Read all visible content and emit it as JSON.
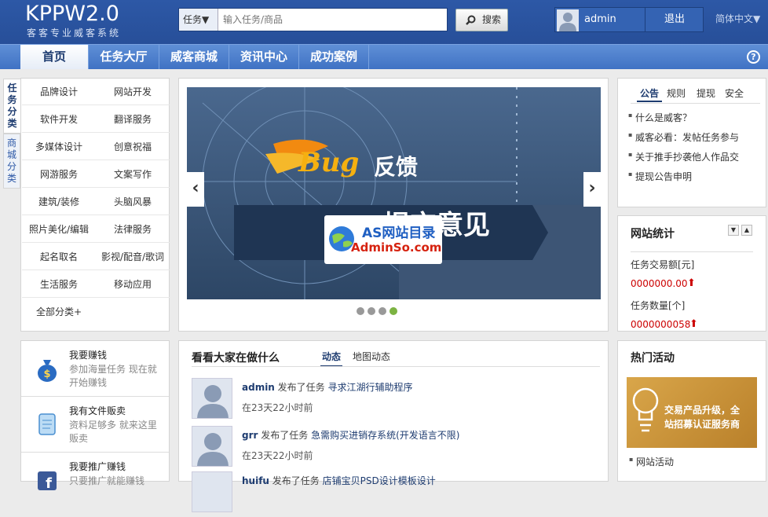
{
  "header": {
    "logo": "KPPW2.0",
    "slogan": "客客专业威客系统",
    "search_type": "任务▼",
    "search_placeholder": "输入任务/商品",
    "search_button": "搜索",
    "username": "admin",
    "logout": "退出",
    "language": "简体中文▼"
  },
  "nav": {
    "items": [
      "首页",
      "任务大厅",
      "威客商城",
      "资讯中心",
      "成功案例"
    ],
    "help": "?"
  },
  "categories": {
    "tabs": [
      "任务分类",
      "商城分类"
    ],
    "items": [
      "品牌设计",
      "网站开发",
      "软件开发",
      "翻译服务",
      "多媒体设计",
      "创意祝福",
      "网游服务",
      "文案写作",
      "建筑/装修",
      "头脑风暴",
      "照片美化/编辑",
      "法律服务",
      "起名取名",
      "影视/配音/歌词",
      "生活服务",
      "移动应用"
    ],
    "all": "全部分类+"
  },
  "banner": {
    "bug": "Bug",
    "title1": "反馈",
    "title2": "提交意见",
    "watermark_top": "AS网站目录",
    "watermark_bottom": "AdminSo.com",
    "prev": "‹",
    "next": "›",
    "active_dot": 4
  },
  "notice": {
    "tabs": [
      "公告",
      "规则",
      "提现",
      "安全"
    ],
    "items": [
      "什么是威客？",
      "威客必看：发帖任务参与",
      "关于推手抄袭他人作品交",
      "提现公告申明"
    ]
  },
  "stats": {
    "title": "网站统计",
    "label1": "任务交易额[元]",
    "value1": "0000000.00",
    "label2": "任务数量[个]",
    "value2": "0000000058",
    "accent": "#cc0000"
  },
  "earn": {
    "items": [
      {
        "title": "我要赚钱",
        "desc": "参加海量任务 现在就开始赚钱"
      },
      {
        "title": "我有文件贩卖",
        "desc": "资料足够多 就来这里贩卖"
      },
      {
        "title": "我要推广赚钱",
        "desc": "只要推广就能赚钱"
      }
    ]
  },
  "activity": {
    "title": "看看大家在做什么",
    "tabs": [
      "动态",
      "地图动态"
    ],
    "items": [
      {
        "user": "admin",
        "action": " 发布了任务 ",
        "task": "寻求江湖行辅助程序",
        "time": "在23天22小时前"
      },
      {
        "user": "grr",
        "action": " 发布了任务 ",
        "task": "急需购买进销存系统(开发语言不限)",
        "time": "在23天22小时前"
      },
      {
        "user": "huifu",
        "action": " 发布了任务 ",
        "task": "店铺宝贝PSD设计模板设计",
        "time": ""
      }
    ]
  },
  "hot": {
    "title": "热门活动",
    "image_text1": "交易产品升级，全",
    "image_text2": "站招募认证服务商",
    "link": "网站活动"
  }
}
